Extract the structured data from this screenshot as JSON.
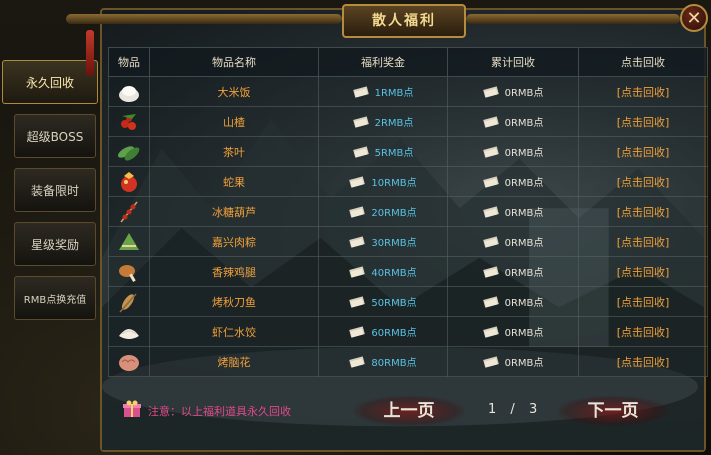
{
  "title": "散人福利",
  "tabs": [
    "永久回收",
    "超级BOSS",
    "装备限时",
    "星级奖励",
    "RMB点换充值"
  ],
  "columns": [
    "物品",
    "物品名称",
    "福利奖金",
    "累计回收",
    "点击回收"
  ],
  "rows": [
    {
      "icon": "rice-bag-icon",
      "name": "大米饭",
      "bonus": "1RMB点",
      "total": "0RMB点",
      "action": "[点击回收]"
    },
    {
      "icon": "hawthorn-icon",
      "name": "山楂",
      "bonus": "2RMB点",
      "total": "0RMB点",
      "action": "[点击回收]"
    },
    {
      "icon": "tea-leaf-icon",
      "name": "茶叶",
      "bonus": "5RMB点",
      "total": "0RMB点",
      "action": "[点击回收]"
    },
    {
      "icon": "snake-fruit-icon",
      "name": "蛇果",
      "bonus": "10RMB点",
      "total": "0RMB点",
      "action": "[点击回收]"
    },
    {
      "icon": "candied-haws-icon",
      "name": "冰糖葫芦",
      "bonus": "20RMB点",
      "total": "0RMB点",
      "action": "[点击回收]"
    },
    {
      "icon": "zongzi-icon",
      "name": "嘉兴肉粽",
      "bonus": "30RMB点",
      "total": "0RMB点",
      "action": "[点击回收]"
    },
    {
      "icon": "chicken-leg-icon",
      "name": "香辣鸡腿",
      "bonus": "40RMB点",
      "total": "0RMB点",
      "action": "[点击回收]"
    },
    {
      "icon": "grilled-fish-icon",
      "name": "烤秋刀鱼",
      "bonus": "50RMB点",
      "total": "0RMB点",
      "action": "[点击回收]"
    },
    {
      "icon": "dumpling-icon",
      "name": "虾仁水饺",
      "bonus": "60RMB点",
      "total": "0RMB点",
      "action": "[点击回收]"
    },
    {
      "icon": "roasted-brain-icon",
      "name": "烤脑花",
      "bonus": "80RMB点",
      "total": "0RMB点",
      "action": "[点击回收]"
    }
  ],
  "footer": {
    "note": "注意：以上福利道具永久回收",
    "prev": "上一页",
    "page": "1",
    "sep": "/",
    "total": "3",
    "next": "下一页"
  },
  "colors": {
    "accent": "#f0a13a",
    "bonus": "#59c3e3",
    "note": "#e14a8b",
    "frame": "#b58b3e"
  }
}
